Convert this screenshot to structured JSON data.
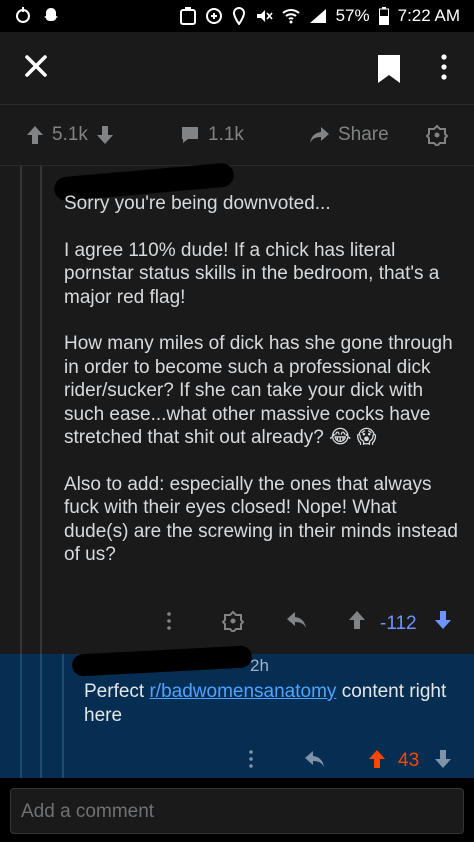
{
  "status_bar": {
    "battery": "57%",
    "time": "7:22 AM",
    "icons": [
      "notification-icon",
      "snapchat-icon",
      "app-icon",
      "sync-icon",
      "location-icon",
      "mute-icon",
      "wifi-icon",
      "signal-icon",
      "battery-icon"
    ]
  },
  "toolbar": {
    "icons": [
      "close-icon",
      "bookmark-icon",
      "overflow-menu-icon"
    ]
  },
  "post_actions": {
    "score": "5.1k",
    "comments": "1.1k",
    "share_label": "Share"
  },
  "comment": {
    "paragraphs": [
      "Sorry you're being downvoted...",
      "I agree 110% dude! If a chick has literal pornstar status skills in the bedroom, that's a major red flag!",
      "How many miles of dick has she gone through in order to become such a professional dick rider/sucker? If she can take your dick with such ease...what other massive cocks have stretched that shit out already? 😂 😱",
      "Also to add: especially the ones that always fuck with their eyes closed! Nope! What dude(s) are the screwing in their minds instead of us?"
    ],
    "score": "-112",
    "colors": {
      "score": "#7193ff"
    }
  },
  "reply": {
    "age": "2h",
    "text_before": "Perfect ",
    "link": "r/badwomensanatomy",
    "text_after": " content right here",
    "score": "43",
    "colors": {
      "score": "#ff4500",
      "background": "#052e52"
    }
  },
  "composer": {
    "placeholder": "Add a comment"
  }
}
